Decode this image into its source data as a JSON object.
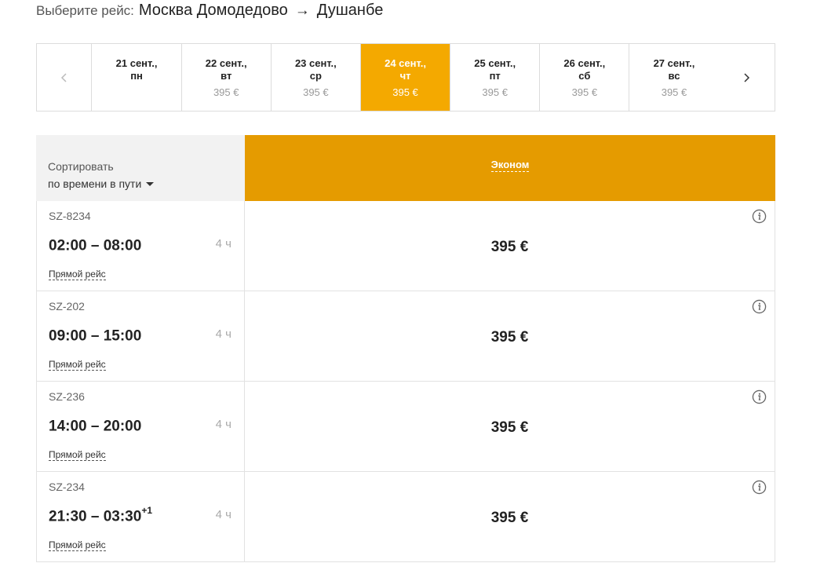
{
  "header": {
    "prefix": "Выберите рейс:",
    "origin": "Москва Домодедово",
    "arrow": "→",
    "destination": "Душанбе"
  },
  "dates": [
    {
      "line1": "21 сент.,",
      "line2": "пн",
      "price": ""
    },
    {
      "line1": "22 сент.,",
      "line2": "вт",
      "price": "395 €"
    },
    {
      "line1": "23 сент.,",
      "line2": "ср",
      "price": "395 €"
    },
    {
      "line1": "24 сент.,",
      "line2": "чт",
      "price": "395 €",
      "active": true
    },
    {
      "line1": "25 сент.,",
      "line2": "пт",
      "price": "395 €"
    },
    {
      "line1": "26 сент.,",
      "line2": "сб",
      "price": "395 €"
    },
    {
      "line1": "27 сент.,",
      "line2": "вс",
      "price": "395 €"
    }
  ],
  "sort": {
    "label": "Сортировать",
    "value": "по времени в пути"
  },
  "fare_class": "Эконом",
  "colors": {
    "active_date": "#f4a900",
    "fare_header": "#e59b00"
  },
  "flights": [
    {
      "number": "SZ-8234",
      "times": "02:00 – 08:00",
      "plus_day": "",
      "duration": "4 ч",
      "type": "Прямой рейс",
      "price": "395 €"
    },
    {
      "number": "SZ-202",
      "times": "09:00 – 15:00",
      "plus_day": "",
      "duration": "4 ч",
      "type": "Прямой рейс",
      "price": "395 €"
    },
    {
      "number": "SZ-236",
      "times": "14:00 – 20:00",
      "plus_day": "",
      "duration": "4 ч",
      "type": "Прямой рейс",
      "price": "395 €"
    },
    {
      "number": "SZ-234",
      "times": "21:30 – 03:30",
      "plus_day": "+1",
      "duration": "4 ч",
      "type": "Прямой рейс",
      "price": "395 €"
    }
  ]
}
